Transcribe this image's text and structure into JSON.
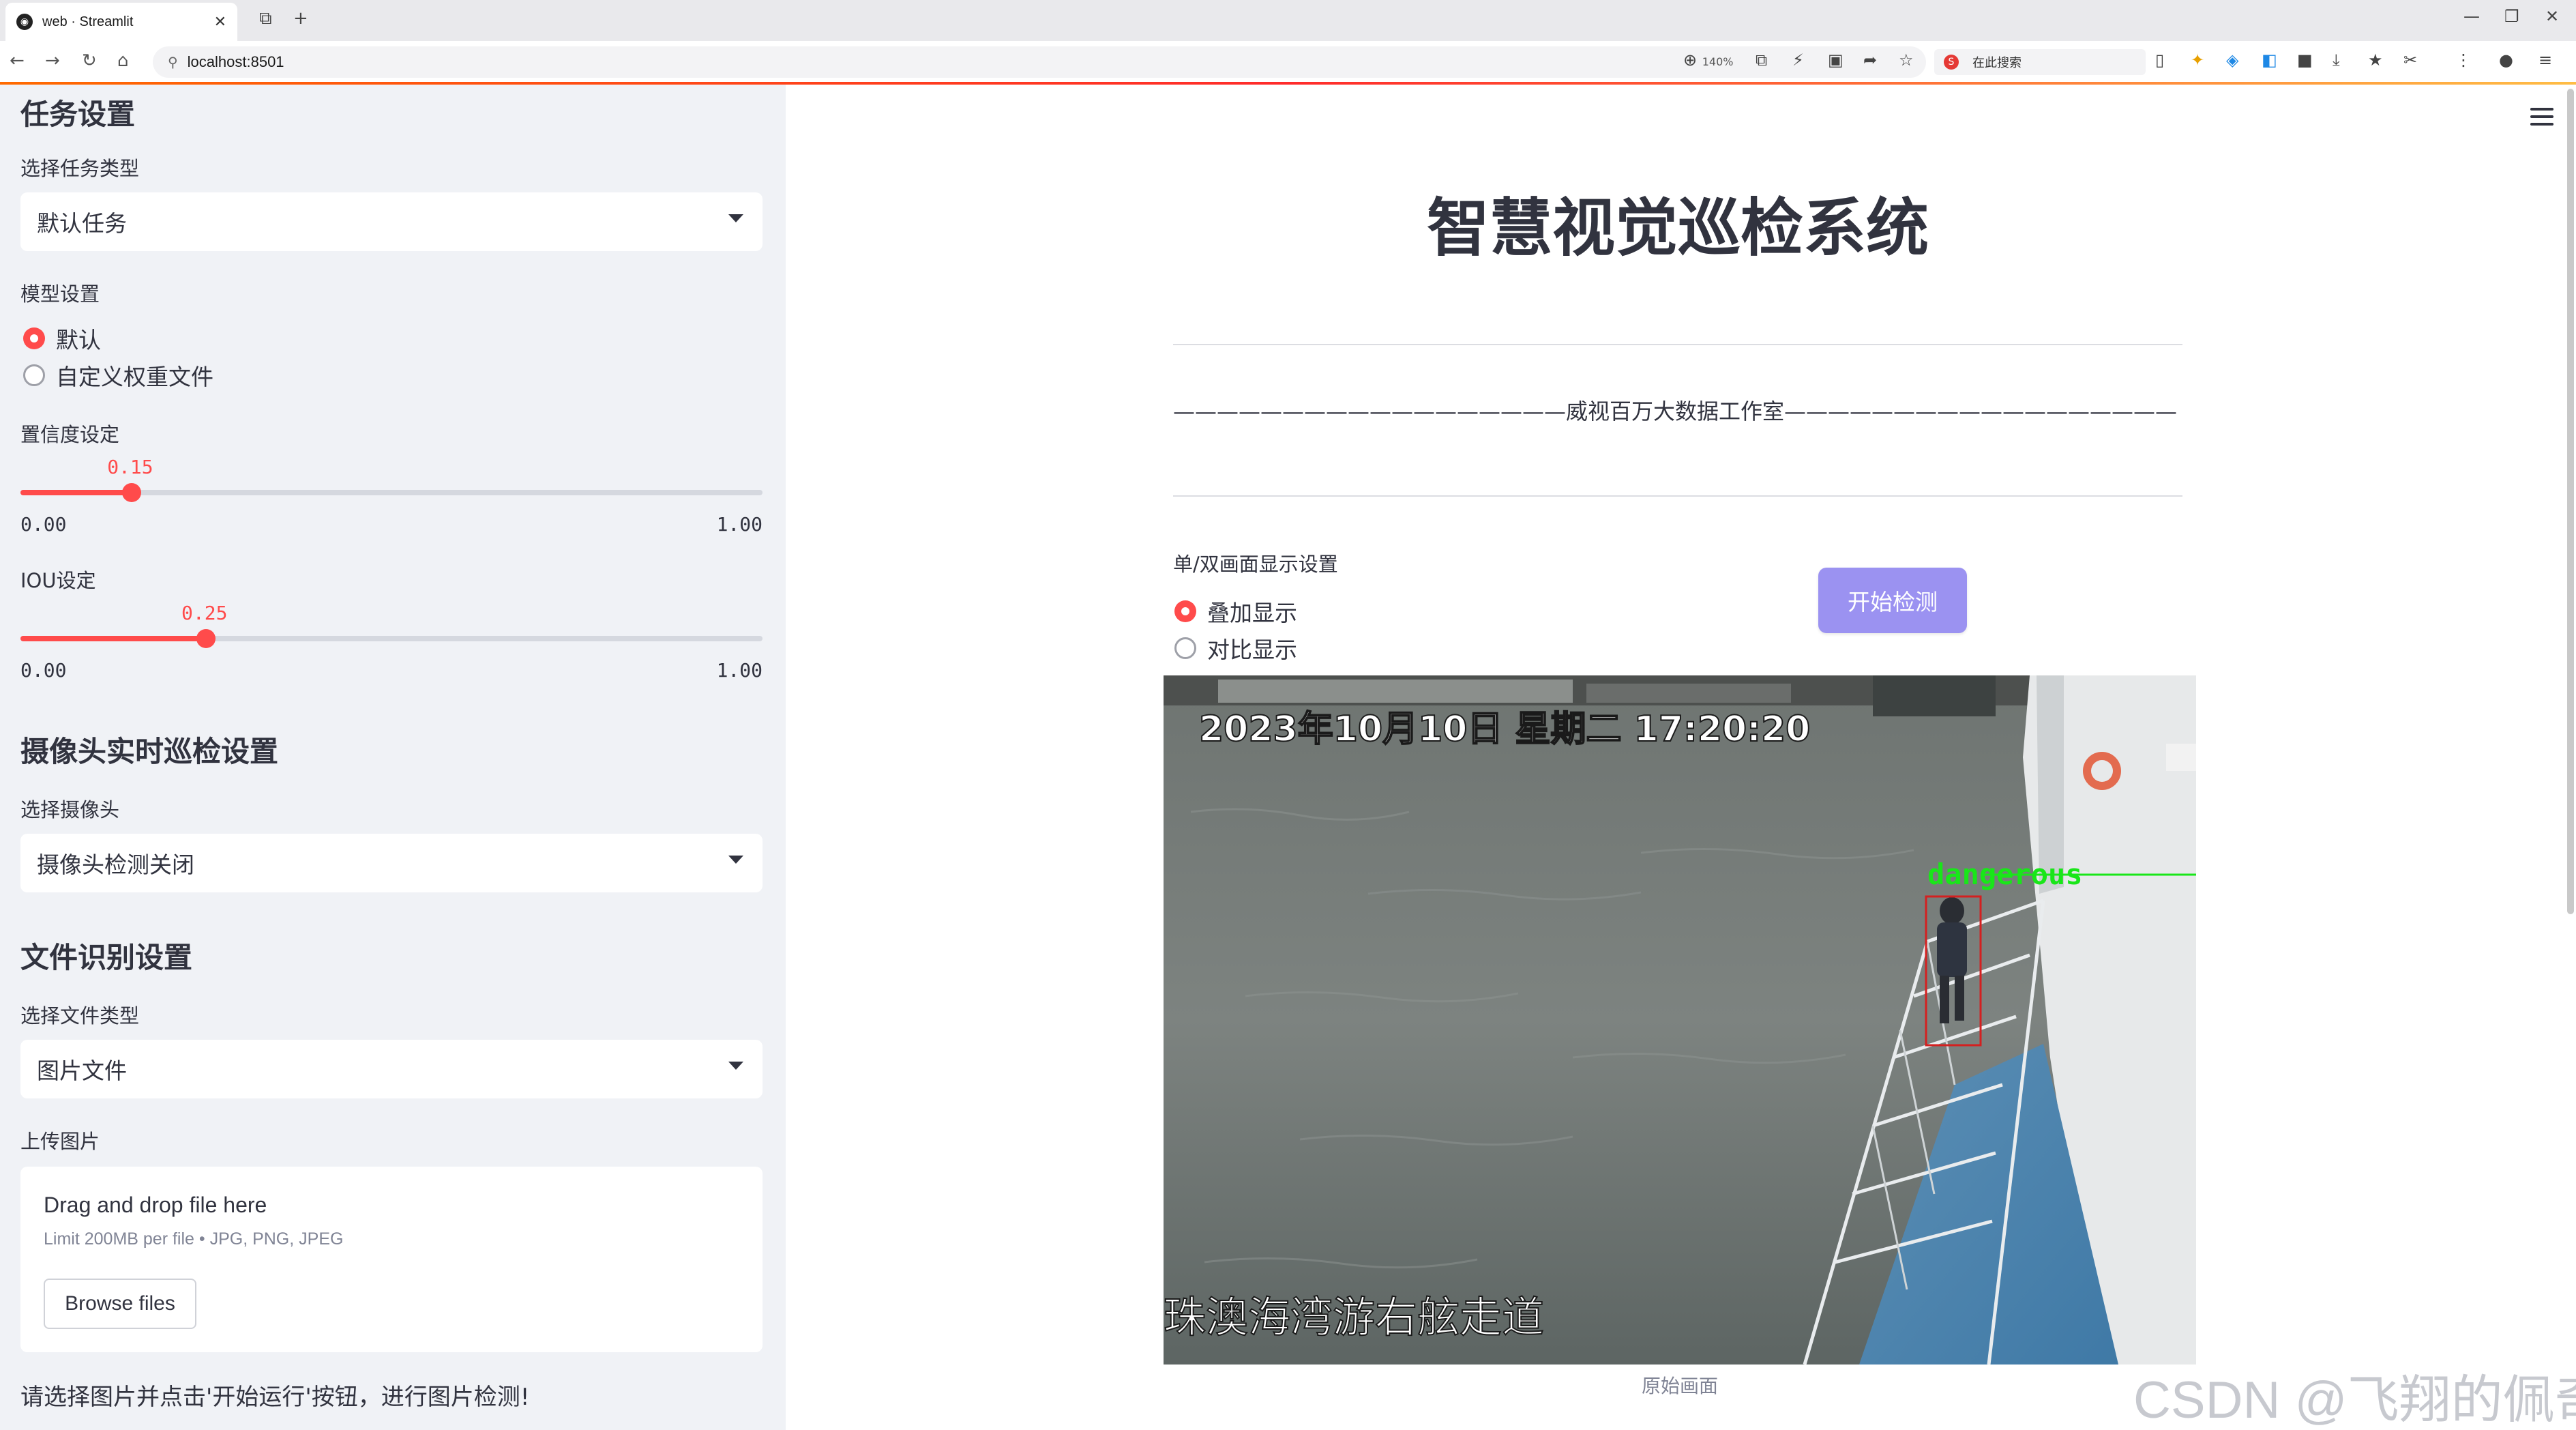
{
  "browser": {
    "tab_title": "web · Streamlit",
    "url": "localhost:8501",
    "zoom": "140%",
    "search_placeholder": "在此搜索"
  },
  "sidebar": {
    "task_section": "任务设置",
    "task_type_label": "选择任务类型",
    "task_type_value": "默认任务",
    "model_label": "模型设置",
    "model_options": [
      "默认",
      "自定义权重文件"
    ],
    "model_selected": "默认",
    "confidence": {
      "label": "置信度设定",
      "value": "0.15",
      "min": "0.00",
      "max": "1.00",
      "fraction": 0.15
    },
    "iou": {
      "label": "IOU设定",
      "value": "0.25",
      "min": "0.00",
      "max": "1.00",
      "fraction": 0.25
    },
    "camera_section": "摄像头实时巡检设置",
    "camera_label": "选择摄像头",
    "camera_value": "摄像头检测关闭",
    "file_section": "文件识别设置",
    "file_type_label": "选择文件类型",
    "file_type_value": "图片文件",
    "upload_label": "上传图片",
    "upload_title": "Drag and drop file here",
    "upload_limit": "Limit 200MB per file • JPG, PNG, JPEG",
    "browse_label": "Browse files",
    "note": "请选择图片并点击'开始运行'按钮，进行图片检测!"
  },
  "main": {
    "title": "智慧视觉巡检系统",
    "banner": "——————————————————威视百万大数据工作室——————————————————",
    "display_label": "单/双画面显示设置",
    "display_options": [
      "叠加显示",
      "对比显示"
    ],
    "display_selected": "叠加显示",
    "start_button": "开始检测",
    "image": {
      "timestamp": "2023年10月10日 星期二 17:20:20",
      "location": "珠澳海湾游右舷走道",
      "detection_label": "dangerous",
      "detection_color": "#19e619",
      "box_color": "#d42020"
    },
    "caption": "原始画面"
  },
  "watermark": "CSDN @飞翔的佩奇",
  "colors": {
    "accent": "#ff4b4b",
    "button": "#9b92f1",
    "sidebar_bg": "#f0f2f6"
  }
}
